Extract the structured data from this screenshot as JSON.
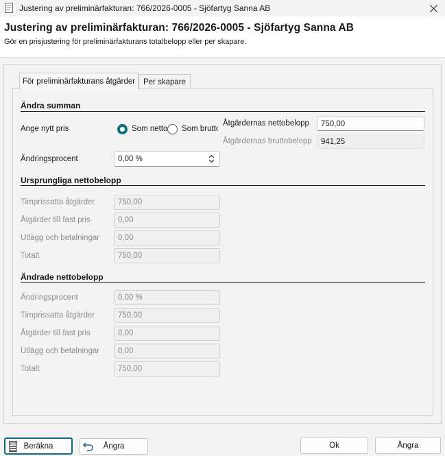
{
  "window": {
    "title": "Justering av preliminärfakturan: 766/2026-0005 - Sjöfartyg Sanna AB"
  },
  "header": {
    "title": "Justering av preliminärfakturan: 766/2026-0005 - Sjöfartyg Sanna AB",
    "subtitle": "Gör en prisjustering för preliminärfakturans totalbelopp eller per skapare."
  },
  "tabs": [
    {
      "label": "För preliminärfakturans åtgärder",
      "active": true
    },
    {
      "label": "Per skapare",
      "active": false
    }
  ],
  "change_sum": {
    "section_title": "Ändra summan",
    "new_price_label": "Ange nytt pris",
    "radio_net_label": "Som netto",
    "radio_gross_label": "Som brutto",
    "selected": "net",
    "net_amount_label": "Åtgärdernas nettobelopp",
    "net_amount_value": "750,00",
    "gross_amount_label": "Åtgärdernas bruttobelopp",
    "gross_amount_value": "941,25",
    "change_percent_label": "Ändringsprocent",
    "change_percent_value": "0,00 %"
  },
  "original_net": {
    "section_title": "Ursprungliga nettobelopp",
    "rows": [
      {
        "label": "Timprissatta åtgärder",
        "value": "750,00"
      },
      {
        "label": "Åtgärder till fast pris",
        "value": "0,00"
      },
      {
        "label": "Utlägg och betalningar",
        "value": "0,00"
      },
      {
        "label": "Totalt",
        "value": "750,00"
      }
    ]
  },
  "changed_net": {
    "section_title": "Ändrade nettobelopp",
    "rows": [
      {
        "label": "Ändringsprocent",
        "value": "0,00 %"
      },
      {
        "label": "Timprissatta åtgärder",
        "value": "750,00"
      },
      {
        "label": "Åtgärder till fast pris",
        "value": "0,00"
      },
      {
        "label": "Utlägg och betalningar",
        "value": "0,00"
      },
      {
        "label": "Totalt",
        "value": "750,00"
      }
    ]
  },
  "buttons": {
    "calculate": "Beräkna",
    "undo": "Ångra",
    "ok": "Ok",
    "cancel": "Ångra"
  },
  "colors": {
    "accent": "#0f6e7a",
    "background": "#f3f3f3"
  }
}
